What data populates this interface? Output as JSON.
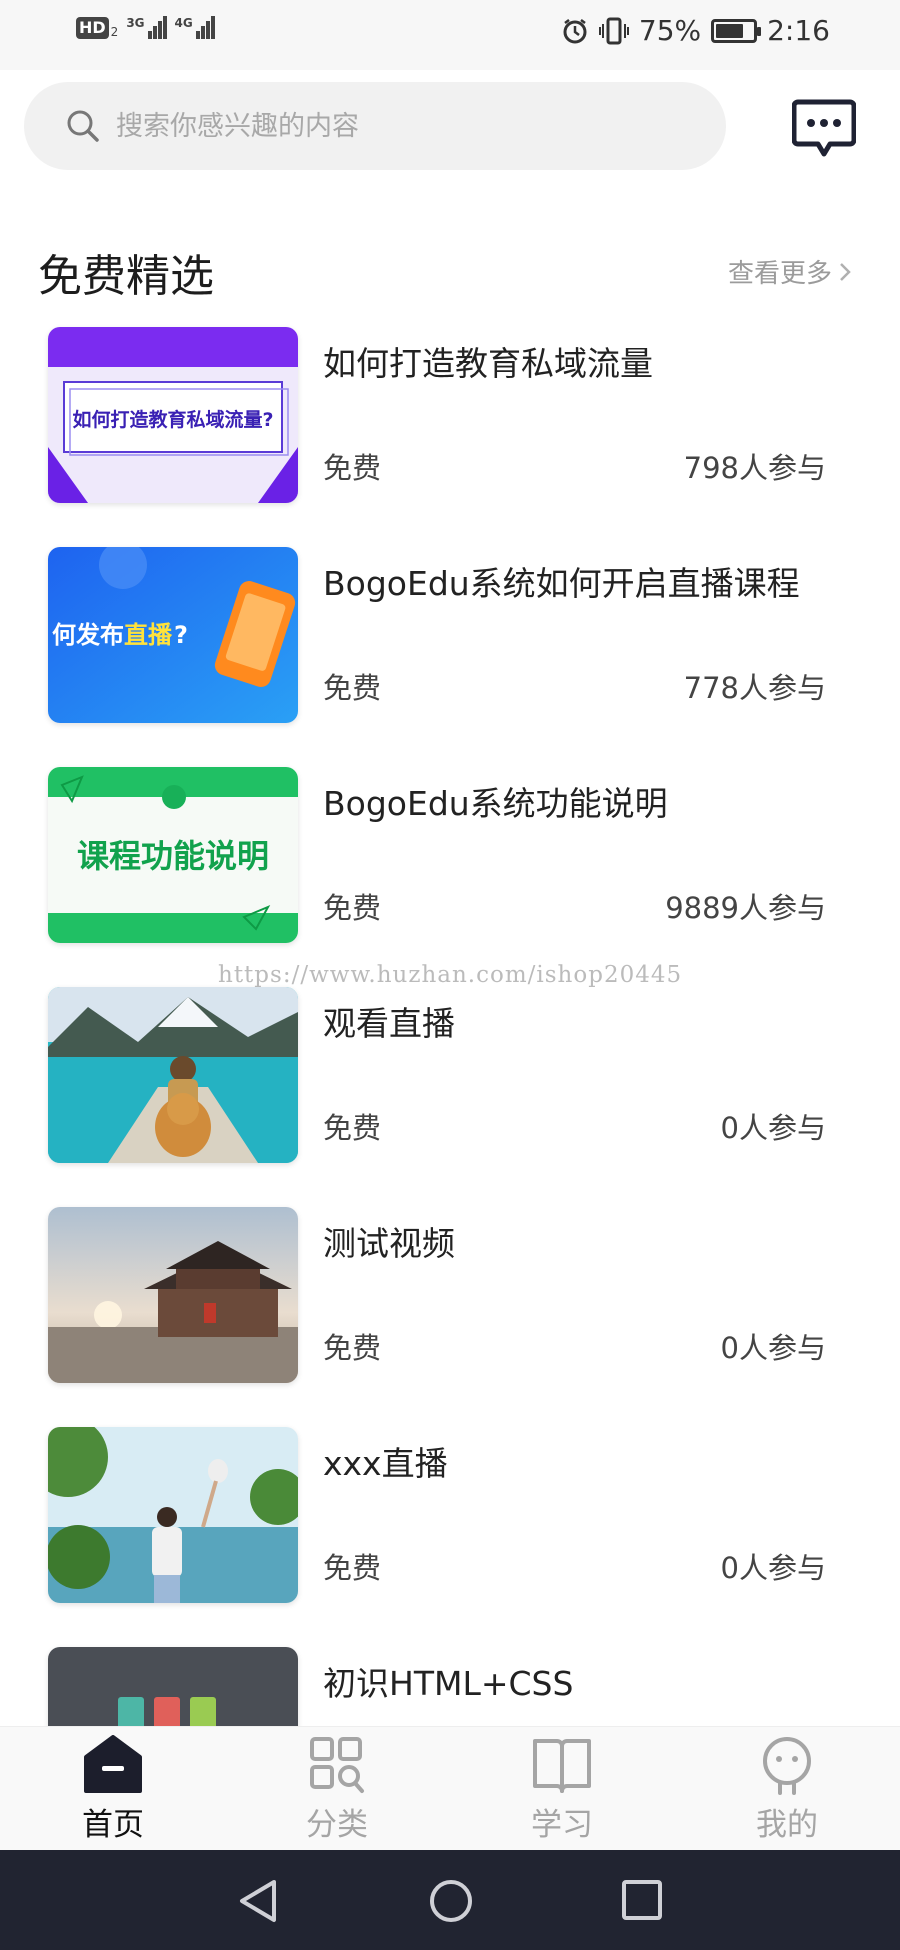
{
  "status_bar": {
    "hd_label": "HD",
    "hd_sub": "2",
    "net1": "3G",
    "net2": "4G",
    "battery_text": "75%",
    "battery_level": 0.75,
    "time": "2:16"
  },
  "search": {
    "placeholder": "搜索你感兴趣的内容",
    "icon": "search-icon"
  },
  "header_actions": {
    "message_icon": "message-icon"
  },
  "section": {
    "title": "免费精选",
    "more_label": "查看更多"
  },
  "courses": [
    {
      "title": "如何打造教育私域流量",
      "price": "免费",
      "participants": "798人参与",
      "thumb_text": "如何打造教育私域流量?"
    },
    {
      "title": "BogoEdu系统如何开启直播课程",
      "price": "免费",
      "participants": "778人参与",
      "thumb_text_a": "何发布",
      "thumb_text_b": "直播",
      "thumb_text_c": "?"
    },
    {
      "title": "BogoEdu系统功能说明",
      "price": "免费",
      "participants": "9889人参与",
      "thumb_text": "课程功能说明"
    },
    {
      "title": "观看直播",
      "price": "免费",
      "participants": "0人参与"
    },
    {
      "title": "测试视频",
      "price": "免费",
      "participants": "0人参与"
    },
    {
      "title": "xxx直播",
      "price": "免费",
      "participants": "0人参与"
    },
    {
      "title": "初识HTML+CSS",
      "price": "",
      "participants": ""
    }
  ],
  "watermark": "https://www.huzhan.com/ishop20445",
  "tabs": [
    {
      "label": "首页",
      "icon": "home-icon",
      "active": true
    },
    {
      "label": "分类",
      "icon": "category-icon",
      "active": false
    },
    {
      "label": "学习",
      "icon": "book-icon",
      "active": false
    },
    {
      "label": "我的",
      "icon": "profile-icon",
      "active": false
    }
  ],
  "colors": {
    "accent": "#111111",
    "inactive_tab": "#a5a5a5",
    "system_nav": "#212431",
    "search_bg": "#f1f1f1"
  }
}
